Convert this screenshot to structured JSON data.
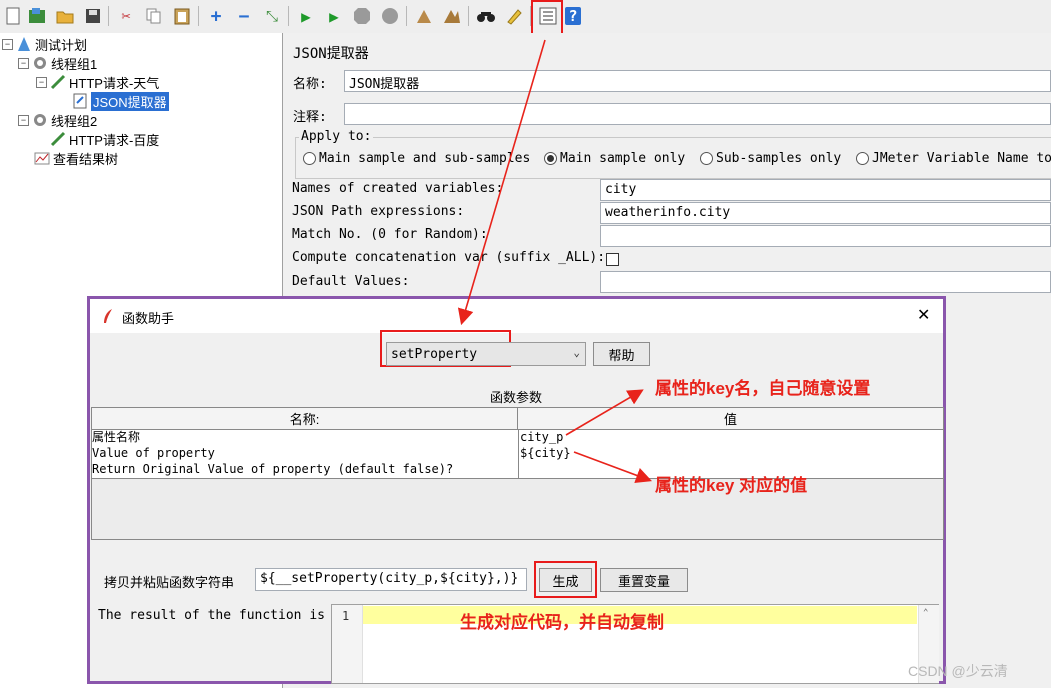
{
  "toolbar": {
    "icons": [
      "new-icon",
      "templates-icon",
      "open-icon",
      "save-icon",
      "cut-icon",
      "copy-icon",
      "paste-icon",
      "expand-icon",
      "collapse-icon",
      "toggle-icon",
      "start-icon",
      "start-no-pause-icon",
      "stop-icon",
      "shutdown-icon",
      "clear-icon",
      "clear-all-icon",
      "search-icon",
      "reset-search-icon",
      "function-helper-icon",
      "help-icon"
    ]
  },
  "tree": {
    "nodes": [
      {
        "label": "测试计划",
        "icon": "test-plan-icon"
      },
      {
        "label": "线程组1",
        "icon": "thread-group-icon"
      },
      {
        "label": "HTTP请求-天气",
        "icon": "sampler-icon"
      },
      {
        "label": "JSON提取器",
        "icon": "extractor-icon"
      },
      {
        "label": "线程组2",
        "icon": "thread-group-icon"
      },
      {
        "label": "HTTP请求-百度",
        "icon": "sampler-icon"
      },
      {
        "label": "查看结果树",
        "icon": "listener-icon"
      }
    ]
  },
  "panel": {
    "title": "JSON提取器",
    "name_label": "名称:",
    "name_value": "JSON提取器",
    "comment_label": "注释:",
    "comment_value": "",
    "apply_to_label": "Apply to:",
    "apply_options": [
      "Main sample and sub-samples",
      "Main sample only",
      "Sub-samples only",
      "JMeter Variable Name to"
    ],
    "apply_selected": 1,
    "fields": [
      {
        "label": "Names of created variables:",
        "value": "city"
      },
      {
        "label": "JSON Path expressions:",
        "value": "weatherinfo.city"
      },
      {
        "label": "Match No. (0 for Random):",
        "value": ""
      },
      {
        "label": "Compute concatenation var (suffix _ALL):",
        "value": ""
      },
      {
        "label": "Default Values:",
        "value": ""
      }
    ]
  },
  "dialog": {
    "title": "函数助手",
    "close": "✕",
    "function_selected": "setProperty",
    "help_button": "帮助",
    "params_title": "函数参数",
    "table_headers": [
      "名称:",
      "值"
    ],
    "rows": [
      {
        "name": "属性名称",
        "value": "city_p"
      },
      {
        "name": "Value of property",
        "value": "${city}"
      },
      {
        "name": "Return Original Value of property (default false)?",
        "value": ""
      }
    ],
    "copy_label": "拷贝并粘贴函数字符串",
    "function_string": "${__setProperty(city_p,${city},)}",
    "generate_button": "生成",
    "reset_button": "重置变量",
    "result_label": "The result of the function is",
    "result_line_number": "1"
  },
  "annotations": {
    "key_name": "属性的key名，自己随意设置",
    "key_value": "属性的key 对应的值",
    "generate": "生成对应代码，并自动复制",
    "color": "#e8231b"
  },
  "watermark": "CSDN @少云清"
}
